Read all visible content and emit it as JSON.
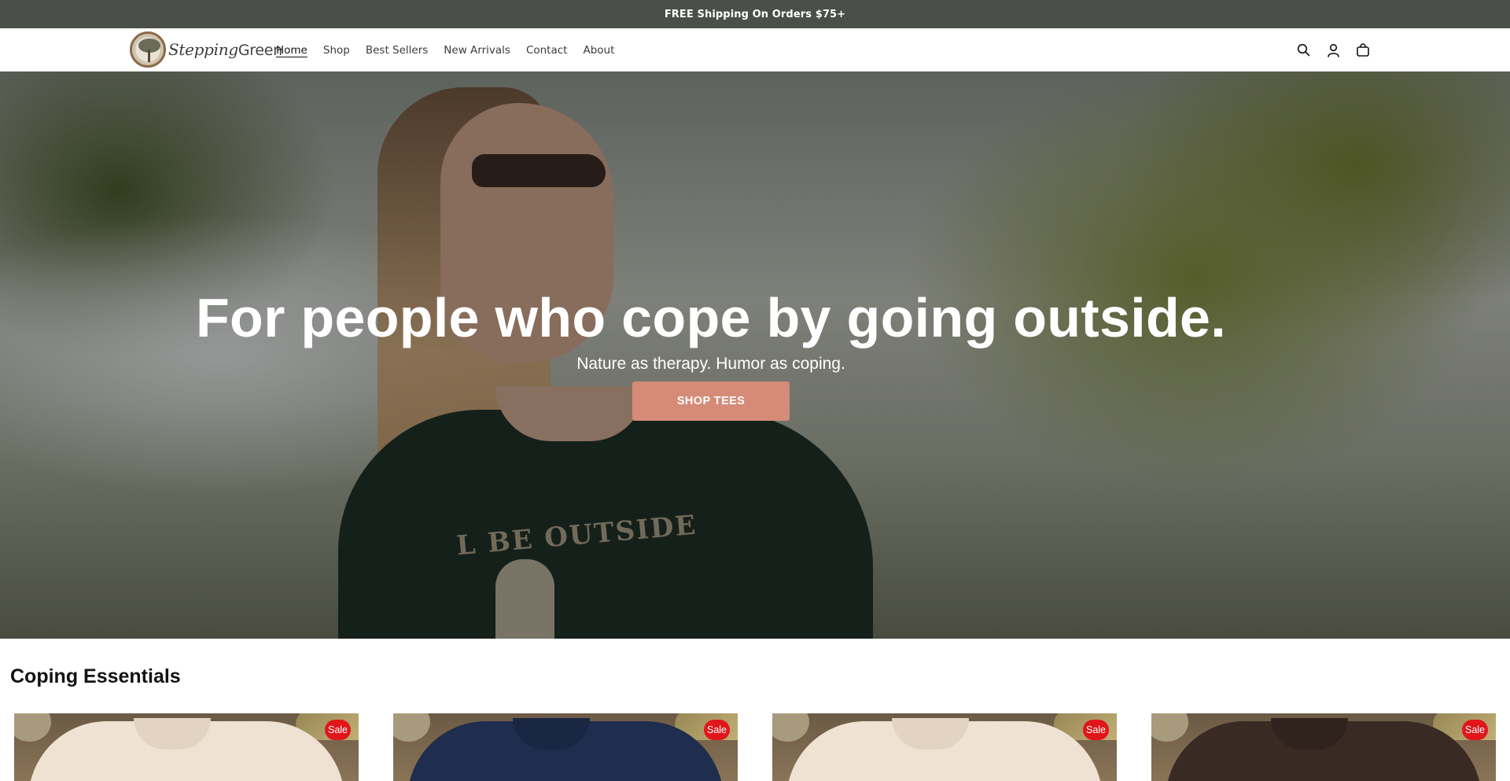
{
  "announcement": {
    "text": "FREE Shipping On Orders $75+"
  },
  "header": {
    "logo_text_italic": "Stepping",
    "logo_text_plain": "Green",
    "nav": [
      {
        "label": "Home",
        "active": true
      },
      {
        "label": "Shop",
        "active": false
      },
      {
        "label": "Best Sellers",
        "active": false
      },
      {
        "label": "New Arrivals",
        "active": false
      },
      {
        "label": "Contact",
        "active": false
      },
      {
        "label": "About",
        "active": false
      }
    ],
    "icons": [
      "search-icon",
      "account-icon",
      "cart-icon"
    ]
  },
  "hero": {
    "title": "For people who cope by going outside.",
    "subtitle": "Nature as therapy. Humor as coping.",
    "button_label": "SHOP TEES",
    "button_color": "#d58b78",
    "shirt_graphic_text": "L BE OUTSIDE"
  },
  "collection": {
    "title": "Coping Essentials",
    "products": [
      {
        "badge": "Sale",
        "tee_color": "#efe2d3"
      },
      {
        "badge": "Sale",
        "tee_color": "#1f2d4e"
      },
      {
        "badge": "Sale",
        "tee_color": "#efe2d3"
      },
      {
        "badge": "Sale",
        "tee_color": "#3a2a24"
      }
    ]
  },
  "colors": {
    "announcement_bg": "#4a4f4a",
    "sale_badge": "#e0161b"
  }
}
